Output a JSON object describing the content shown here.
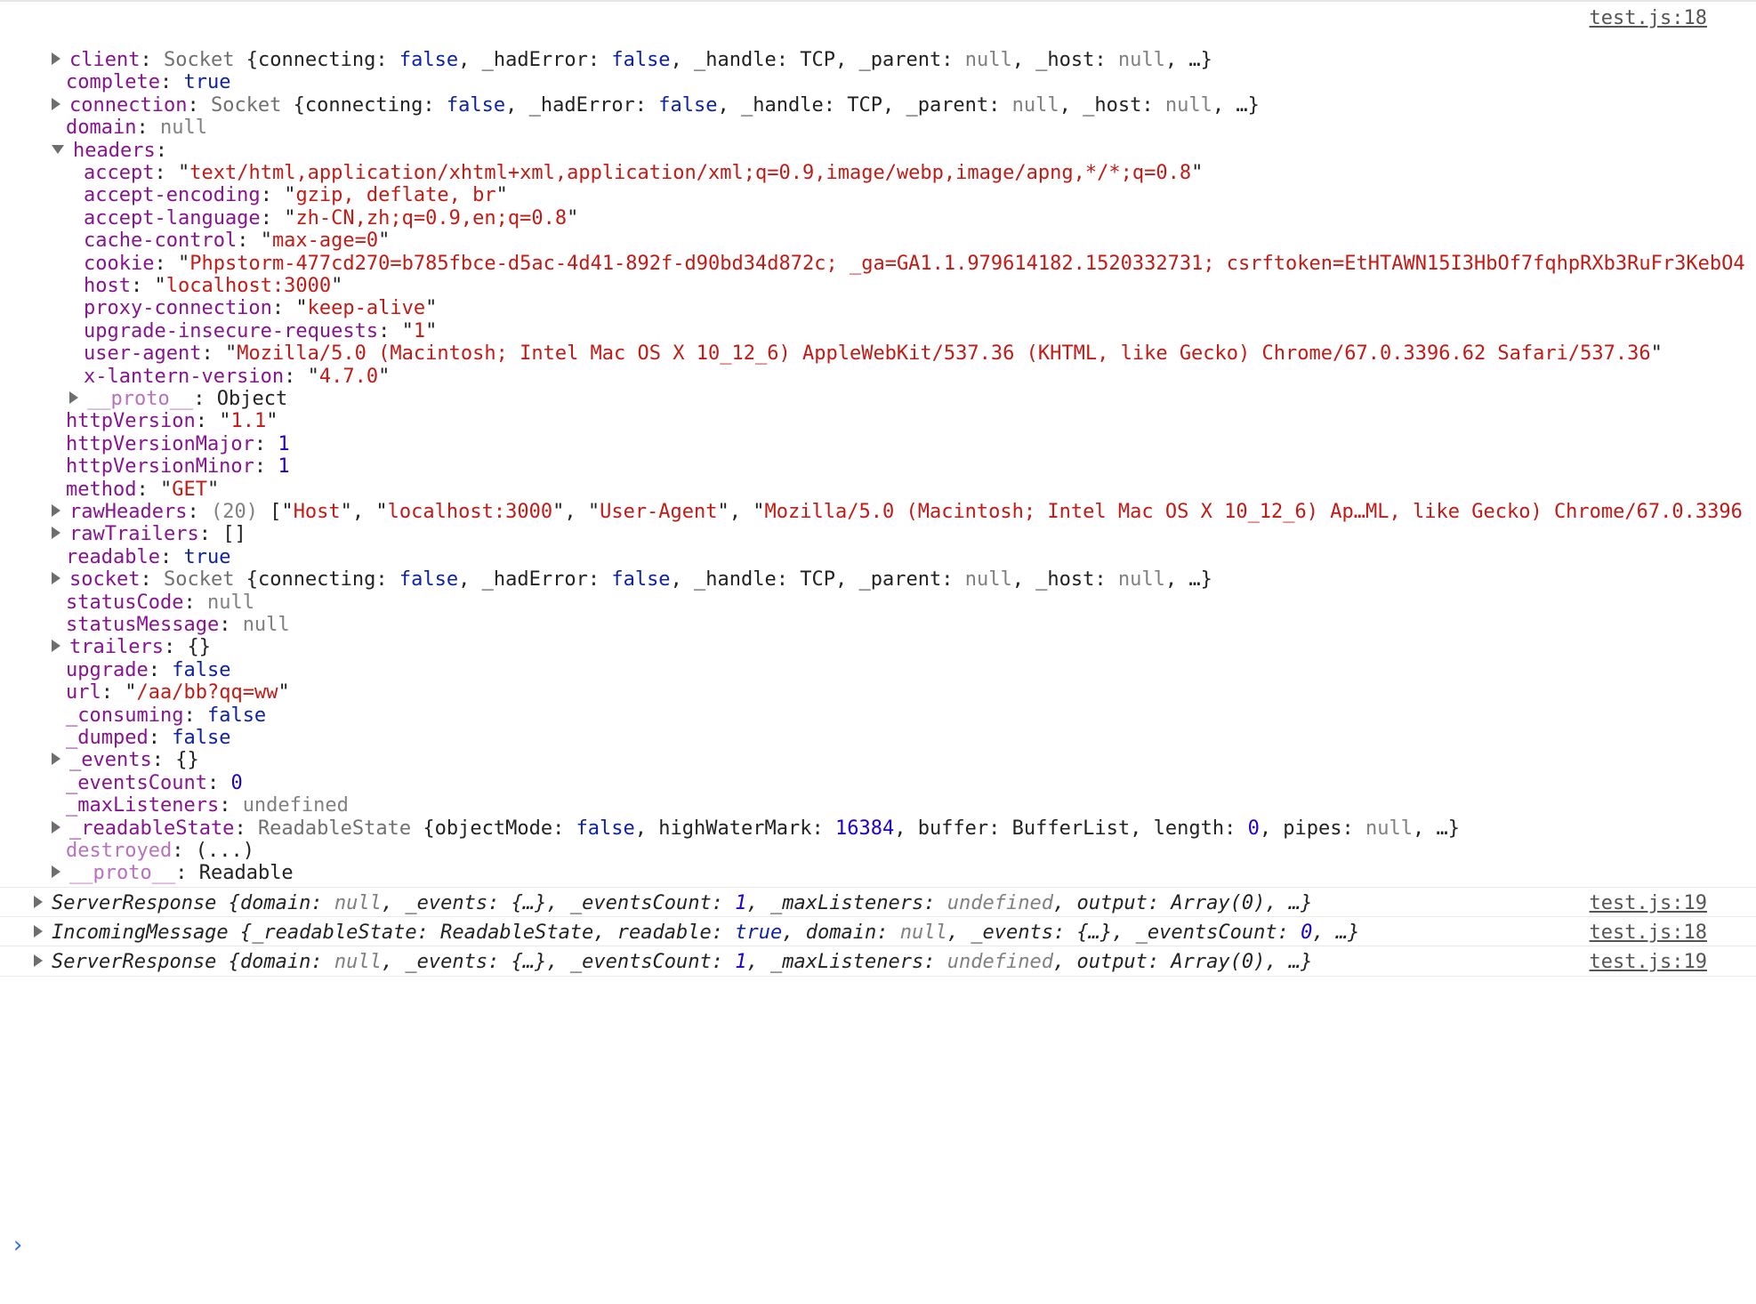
{
  "top_message": {
    "source": "test.js:18",
    "summary": {
      "cls": "IncomingMessage",
      "parts": [
        {
          "t": "p",
          "v": " {"
        },
        {
          "t": "k",
          "v": "_readableState"
        },
        {
          "t": "p",
          "v": ": ReadableState, "
        },
        {
          "t": "k",
          "v": "readable"
        },
        {
          "t": "p",
          "v": ": "
        },
        {
          "t": "b",
          "v": "true"
        },
        {
          "t": "p",
          "v": ", "
        },
        {
          "t": "k",
          "v": "domain"
        },
        {
          "t": "p",
          "v": ": "
        },
        {
          "t": "n",
          "v": "null"
        },
        {
          "t": "p",
          "v": ", "
        },
        {
          "t": "k",
          "v": "_events"
        },
        {
          "t": "p",
          "v": ": {…}, "
        },
        {
          "t": "k",
          "v": "_eventsCount"
        },
        {
          "t": "p",
          "v": ": "
        },
        {
          "t": "num",
          "v": "0"
        },
        {
          "t": "p",
          "v": ", …}"
        }
      ]
    },
    "info_icon": "info-icon",
    "props": [
      {
        "indent": 1,
        "tri": "right",
        "key": "client",
        "val": [
          {
            "t": "c",
            "v": "Socket"
          },
          {
            "t": "p",
            "v": " {connecting: "
          },
          {
            "t": "b",
            "v": "false"
          },
          {
            "t": "p",
            "v": ", _hadError: "
          },
          {
            "t": "b",
            "v": "false"
          },
          {
            "t": "p",
            "v": ", _handle: TCP, _parent: "
          },
          {
            "t": "n",
            "v": "null"
          },
          {
            "t": "p",
            "v": ", _host: "
          },
          {
            "t": "n",
            "v": "null"
          },
          {
            "t": "p",
            "v": ", …}"
          }
        ]
      },
      {
        "indent": 1,
        "key": "complete",
        "val": [
          {
            "t": "b",
            "v": "true"
          }
        ]
      },
      {
        "indent": 1,
        "tri": "right",
        "key": "connection",
        "val": [
          {
            "t": "c",
            "v": "Socket"
          },
          {
            "t": "p",
            "v": " {connecting: "
          },
          {
            "t": "b",
            "v": "false"
          },
          {
            "t": "p",
            "v": ", _hadError: "
          },
          {
            "t": "b",
            "v": "false"
          },
          {
            "t": "p",
            "v": ", _handle: TCP, _parent: "
          },
          {
            "t": "n",
            "v": "null"
          },
          {
            "t": "p",
            "v": ", _host: "
          },
          {
            "t": "n",
            "v": "null"
          },
          {
            "t": "p",
            "v": ", …}"
          }
        ]
      },
      {
        "indent": 1,
        "key": "domain",
        "val": [
          {
            "t": "n",
            "v": "null"
          }
        ]
      },
      {
        "indent": 1,
        "tri": "down",
        "key": "headers",
        "val": []
      },
      {
        "indent": 2,
        "key": "accept",
        "val": [
          {
            "t": "p",
            "v": "\""
          },
          {
            "t": "s",
            "v": "text/html,application/xhtml+xml,application/xml;q=0.9,image/webp,image/apng,*/*;q=0.8"
          },
          {
            "t": "p",
            "v": "\""
          }
        ]
      },
      {
        "indent": 2,
        "key": "accept-encoding",
        "val": [
          {
            "t": "p",
            "v": "\""
          },
          {
            "t": "s",
            "v": "gzip, deflate, br"
          },
          {
            "t": "p",
            "v": "\""
          }
        ]
      },
      {
        "indent": 2,
        "key": "accept-language",
        "val": [
          {
            "t": "p",
            "v": "\""
          },
          {
            "t": "s",
            "v": "zh-CN,zh;q=0.9,en;q=0.8"
          },
          {
            "t": "p",
            "v": "\""
          }
        ]
      },
      {
        "indent": 2,
        "key": "cache-control",
        "val": [
          {
            "t": "p",
            "v": "\""
          },
          {
            "t": "s",
            "v": "max-age=0"
          },
          {
            "t": "p",
            "v": "\""
          }
        ]
      },
      {
        "indent": 2,
        "key": "cookie",
        "val": [
          {
            "t": "p",
            "v": "\""
          },
          {
            "t": "s",
            "v": "Phpstorm-477cd270=b785fbce-d5ac-4d41-892f-d90bd34d872c; _ga=GA1.1.979614182.1520332731; csrftoken=EtHTAWN15I3HbOf7fqhpRXb3RuFr3KebO4"
          }
        ]
      },
      {
        "indent": 2,
        "key": "host",
        "val": [
          {
            "t": "p",
            "v": "\""
          },
          {
            "t": "s",
            "v": "localhost:3000"
          },
          {
            "t": "p",
            "v": "\""
          }
        ]
      },
      {
        "indent": 2,
        "key": "proxy-connection",
        "val": [
          {
            "t": "p",
            "v": "\""
          },
          {
            "t": "s",
            "v": "keep-alive"
          },
          {
            "t": "p",
            "v": "\""
          }
        ]
      },
      {
        "indent": 2,
        "key": "upgrade-insecure-requests",
        "val": [
          {
            "t": "p",
            "v": "\""
          },
          {
            "t": "s",
            "v": "1"
          },
          {
            "t": "p",
            "v": "\""
          }
        ]
      },
      {
        "indent": 2,
        "key": "user-agent",
        "val": [
          {
            "t": "p",
            "v": "\""
          },
          {
            "t": "s",
            "v": "Mozilla/5.0 (Macintosh; Intel Mac OS X 10_12_6) AppleWebKit/537.36 (KHTML, like Gecko) Chrome/67.0.3396.62 Safari/537.36"
          },
          {
            "t": "p",
            "v": "\""
          }
        ]
      },
      {
        "indent": 2,
        "key": "x-lantern-version",
        "val": [
          {
            "t": "p",
            "v": "\""
          },
          {
            "t": "s",
            "v": "4.7.0"
          },
          {
            "t": "p",
            "v": "\""
          }
        ]
      },
      {
        "indent": 2,
        "tri": "right",
        "key": "__proto__",
        "dim": true,
        "val": [
          {
            "t": "p",
            "v": "Object"
          }
        ]
      },
      {
        "indent": 1,
        "key": "httpVersion",
        "val": [
          {
            "t": "p",
            "v": "\""
          },
          {
            "t": "s",
            "v": "1.1"
          },
          {
            "t": "p",
            "v": "\""
          }
        ]
      },
      {
        "indent": 1,
        "key": "httpVersionMajor",
        "val": [
          {
            "t": "num",
            "v": "1"
          }
        ]
      },
      {
        "indent": 1,
        "key": "httpVersionMinor",
        "val": [
          {
            "t": "num",
            "v": "1"
          }
        ]
      },
      {
        "indent": 1,
        "key": "method",
        "val": [
          {
            "t": "p",
            "v": "\""
          },
          {
            "t": "s",
            "v": "GET"
          },
          {
            "t": "p",
            "v": "\""
          }
        ]
      },
      {
        "indent": 1,
        "tri": "right",
        "key": "rawHeaders",
        "val": [
          {
            "t": "n",
            "v": "(20)"
          },
          {
            "t": "p",
            "v": " [\""
          },
          {
            "t": "s",
            "v": "Host"
          },
          {
            "t": "p",
            "v": "\", \""
          },
          {
            "t": "s",
            "v": "localhost:3000"
          },
          {
            "t": "p",
            "v": "\", \""
          },
          {
            "t": "s",
            "v": "User-Agent"
          },
          {
            "t": "p",
            "v": "\", \""
          },
          {
            "t": "s",
            "v": "Mozilla/5.0 (Macintosh; Intel Mac OS X 10_12_6) Ap…ML, like Gecko) Chrome/67.0.3396"
          }
        ]
      },
      {
        "indent": 1,
        "tri": "right",
        "key": "rawTrailers",
        "val": [
          {
            "t": "p",
            "v": "[]"
          }
        ]
      },
      {
        "indent": 1,
        "key": "readable",
        "val": [
          {
            "t": "b",
            "v": "true"
          }
        ]
      },
      {
        "indent": 1,
        "tri": "right",
        "key": "socket",
        "val": [
          {
            "t": "c",
            "v": "Socket"
          },
          {
            "t": "p",
            "v": " {connecting: "
          },
          {
            "t": "b",
            "v": "false"
          },
          {
            "t": "p",
            "v": ", _hadError: "
          },
          {
            "t": "b",
            "v": "false"
          },
          {
            "t": "p",
            "v": ", _handle: TCP, _parent: "
          },
          {
            "t": "n",
            "v": "null"
          },
          {
            "t": "p",
            "v": ", _host: "
          },
          {
            "t": "n",
            "v": "null"
          },
          {
            "t": "p",
            "v": ", …}"
          }
        ]
      },
      {
        "indent": 1,
        "key": "statusCode",
        "val": [
          {
            "t": "n",
            "v": "null"
          }
        ]
      },
      {
        "indent": 1,
        "key": "statusMessage",
        "val": [
          {
            "t": "n",
            "v": "null"
          }
        ]
      },
      {
        "indent": 1,
        "tri": "right",
        "key": "trailers",
        "val": [
          {
            "t": "p",
            "v": "{}"
          }
        ]
      },
      {
        "indent": 1,
        "key": "upgrade",
        "val": [
          {
            "t": "b",
            "v": "false"
          }
        ]
      },
      {
        "indent": 1,
        "key": "url",
        "val": [
          {
            "t": "p",
            "v": "\""
          },
          {
            "t": "s",
            "v": "/aa/bb?qq=ww"
          },
          {
            "t": "p",
            "v": "\""
          }
        ]
      },
      {
        "indent": 1,
        "key": "_consuming",
        "val": [
          {
            "t": "b",
            "v": "false"
          }
        ]
      },
      {
        "indent": 1,
        "key": "_dumped",
        "val": [
          {
            "t": "b",
            "v": "false"
          }
        ]
      },
      {
        "indent": 1,
        "tri": "right",
        "key": "_events",
        "val": [
          {
            "t": "p",
            "v": "{}"
          }
        ]
      },
      {
        "indent": 1,
        "key": "_eventsCount",
        "val": [
          {
            "t": "num",
            "v": "0"
          }
        ]
      },
      {
        "indent": 1,
        "key": "_maxListeners",
        "val": [
          {
            "t": "n",
            "v": "undefined"
          }
        ]
      },
      {
        "indent": 1,
        "tri": "right",
        "key": "_readableState",
        "val": [
          {
            "t": "c",
            "v": "ReadableState"
          },
          {
            "t": "p",
            "v": " {objectMode: "
          },
          {
            "t": "b",
            "v": "false"
          },
          {
            "t": "p",
            "v": ", highWaterMark: "
          },
          {
            "t": "num",
            "v": "16384"
          },
          {
            "t": "p",
            "v": ", buffer: BufferList, length: "
          },
          {
            "t": "num",
            "v": "0"
          },
          {
            "t": "p",
            "v": ", pipes: "
          },
          {
            "t": "n",
            "v": "null"
          },
          {
            "t": "p",
            "v": ", …}"
          }
        ]
      },
      {
        "indent": 1,
        "key": "destroyed",
        "dim": true,
        "val": [
          {
            "t": "p",
            "v": "(...)"
          }
        ]
      },
      {
        "indent": 1,
        "tri": "right",
        "key": "__proto__",
        "dim": true,
        "val": [
          {
            "t": "p",
            "v": "Readable"
          }
        ]
      }
    ]
  },
  "collapsed_messages": [
    {
      "source": "test.js:19",
      "cls": "ServerResponse",
      "parts": [
        {
          "t": "p",
          "v": " {"
        },
        {
          "t": "k",
          "v": "domain"
        },
        {
          "t": "p",
          "v": ": "
        },
        {
          "t": "n",
          "v": "null"
        },
        {
          "t": "p",
          "v": ", "
        },
        {
          "t": "k",
          "v": "_events"
        },
        {
          "t": "p",
          "v": ": {…}, "
        },
        {
          "t": "k",
          "v": "_eventsCount"
        },
        {
          "t": "p",
          "v": ": "
        },
        {
          "t": "num",
          "v": "1"
        },
        {
          "t": "p",
          "v": ", "
        },
        {
          "t": "k",
          "v": "_maxListeners"
        },
        {
          "t": "p",
          "v": ": "
        },
        {
          "t": "n",
          "v": "undefined"
        },
        {
          "t": "p",
          "v": ", "
        },
        {
          "t": "k",
          "v": "output"
        },
        {
          "t": "p",
          "v": ": Array(0), …}"
        }
      ]
    },
    {
      "source": "test.js:18",
      "cls": "IncomingMessage",
      "parts": [
        {
          "t": "p",
          "v": " {"
        },
        {
          "t": "k",
          "v": "_readableState"
        },
        {
          "t": "p",
          "v": ": ReadableState, "
        },
        {
          "t": "k",
          "v": "readable"
        },
        {
          "t": "p",
          "v": ": "
        },
        {
          "t": "b",
          "v": "true"
        },
        {
          "t": "p",
          "v": ", "
        },
        {
          "t": "k",
          "v": "domain"
        },
        {
          "t": "p",
          "v": ": "
        },
        {
          "t": "n",
          "v": "null"
        },
        {
          "t": "p",
          "v": ", "
        },
        {
          "t": "k",
          "v": "_events"
        },
        {
          "t": "p",
          "v": ": {…}, "
        },
        {
          "t": "k",
          "v": "_eventsCount"
        },
        {
          "t": "p",
          "v": ": "
        },
        {
          "t": "num",
          "v": "0"
        },
        {
          "t": "p",
          "v": ", …}"
        }
      ]
    },
    {
      "source": "test.js:19",
      "cls": "ServerResponse",
      "parts": [
        {
          "t": "p",
          "v": " {"
        },
        {
          "t": "k",
          "v": "domain"
        },
        {
          "t": "p",
          "v": ": "
        },
        {
          "t": "n",
          "v": "null"
        },
        {
          "t": "p",
          "v": ", "
        },
        {
          "t": "k",
          "v": "_events"
        },
        {
          "t": "p",
          "v": ": {…}, "
        },
        {
          "t": "k",
          "v": "_eventsCount"
        },
        {
          "t": "p",
          "v": ": "
        },
        {
          "t": "num",
          "v": "1"
        },
        {
          "t": "p",
          "v": ", "
        },
        {
          "t": "k",
          "v": "_maxListeners"
        },
        {
          "t": "p",
          "v": ": "
        },
        {
          "t": "n",
          "v": "undefined"
        },
        {
          "t": "p",
          "v": ", "
        },
        {
          "t": "k",
          "v": "output"
        },
        {
          "t": "p",
          "v": ": Array(0), …}"
        }
      ]
    }
  ],
  "prompt_symbol": "›",
  "colors": {
    "key": "#881391",
    "string": "#c41a16",
    "number": "#1c00cf",
    "boolean": "#0d22aa",
    "null": "#808080",
    "prompt": "#2f6fec"
  }
}
